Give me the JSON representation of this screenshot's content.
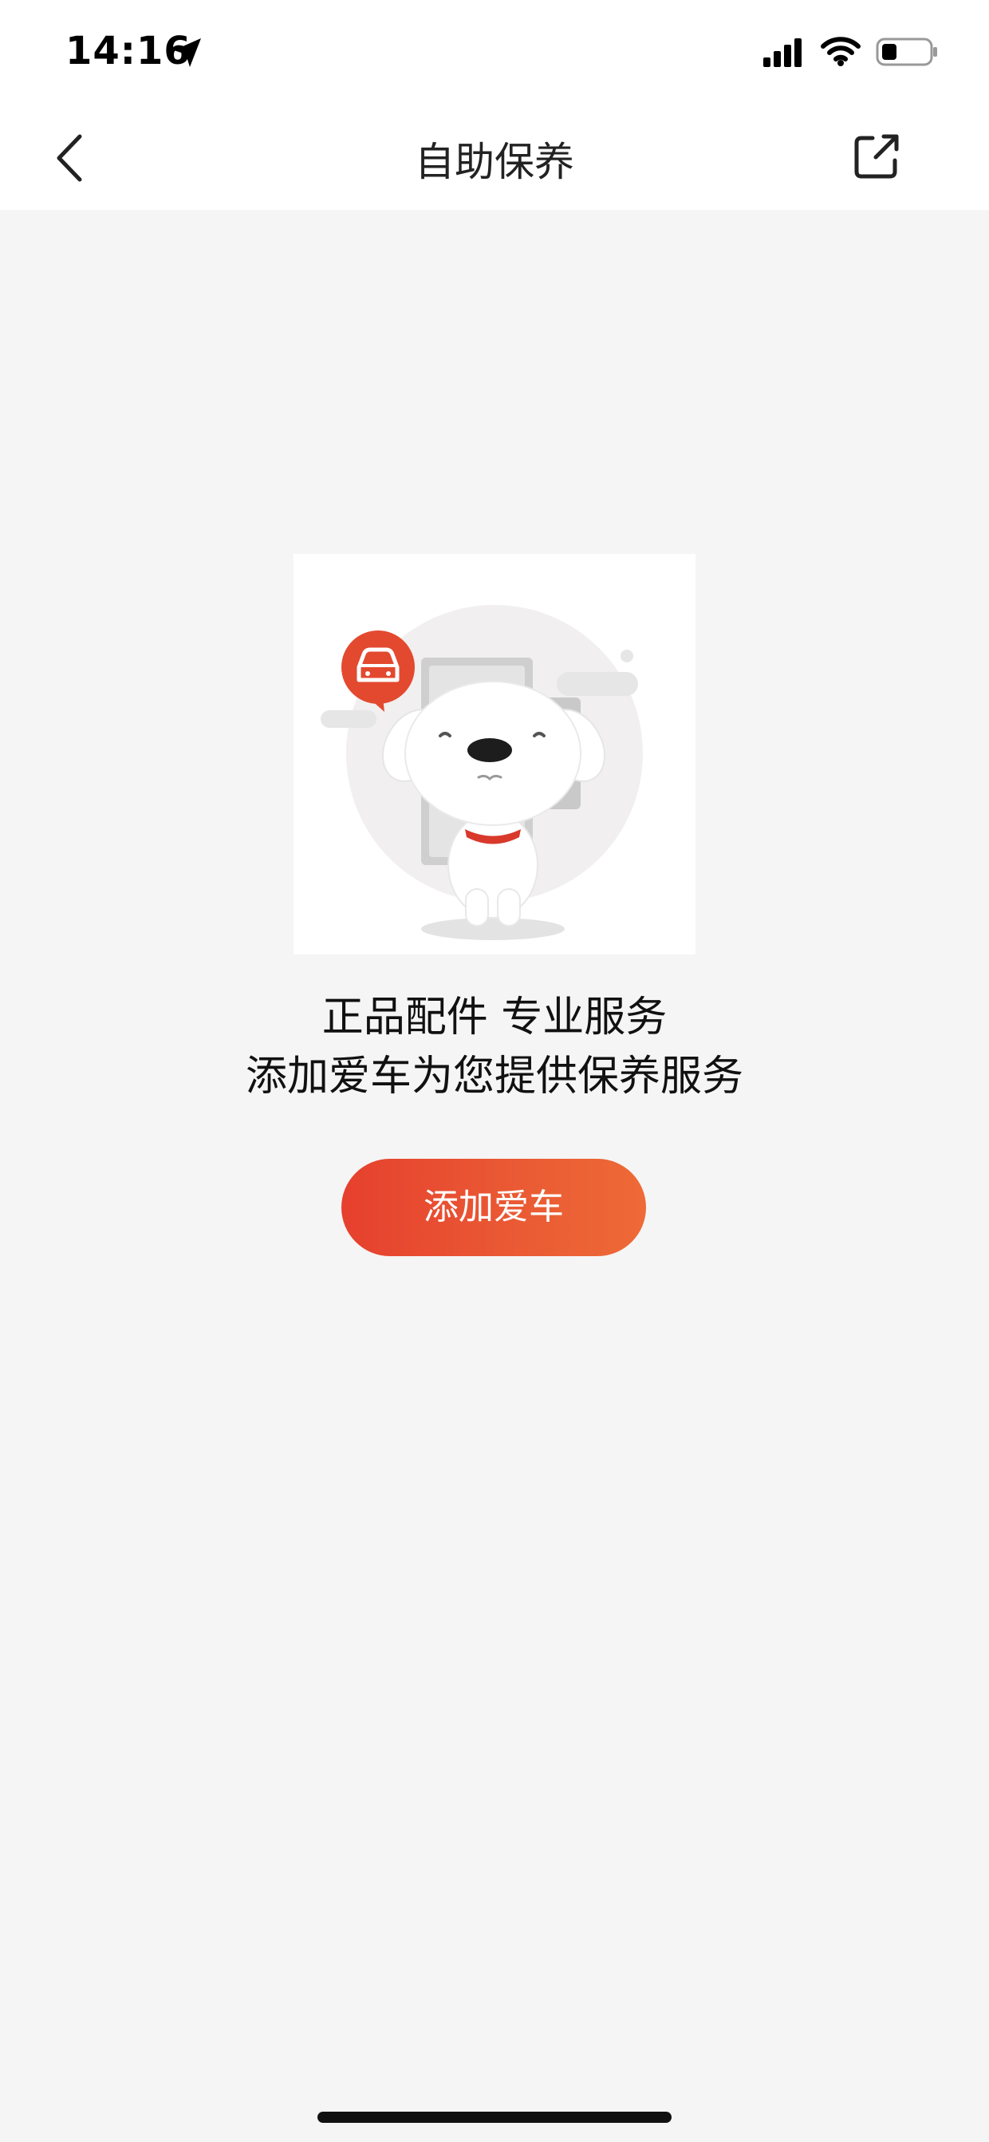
{
  "status_bar": {
    "time": "14:16",
    "icons": [
      "location-arrow-icon",
      "signal-icon",
      "wifi-icon",
      "battery-icon"
    ]
  },
  "nav": {
    "title": "自助保养",
    "back_icon": "chevron-left-icon",
    "share_icon": "share-icon"
  },
  "empty_state": {
    "illustration": "dog-mascot-with-car-bubble",
    "line1": "正品配件 专业服务",
    "line2": "添加爱车为您提供保养服务",
    "button_label": "添加爱车"
  },
  "colors": {
    "accent_start": "#e6402e",
    "accent_end": "#ee6a36",
    "background": "#f5f5f5"
  }
}
